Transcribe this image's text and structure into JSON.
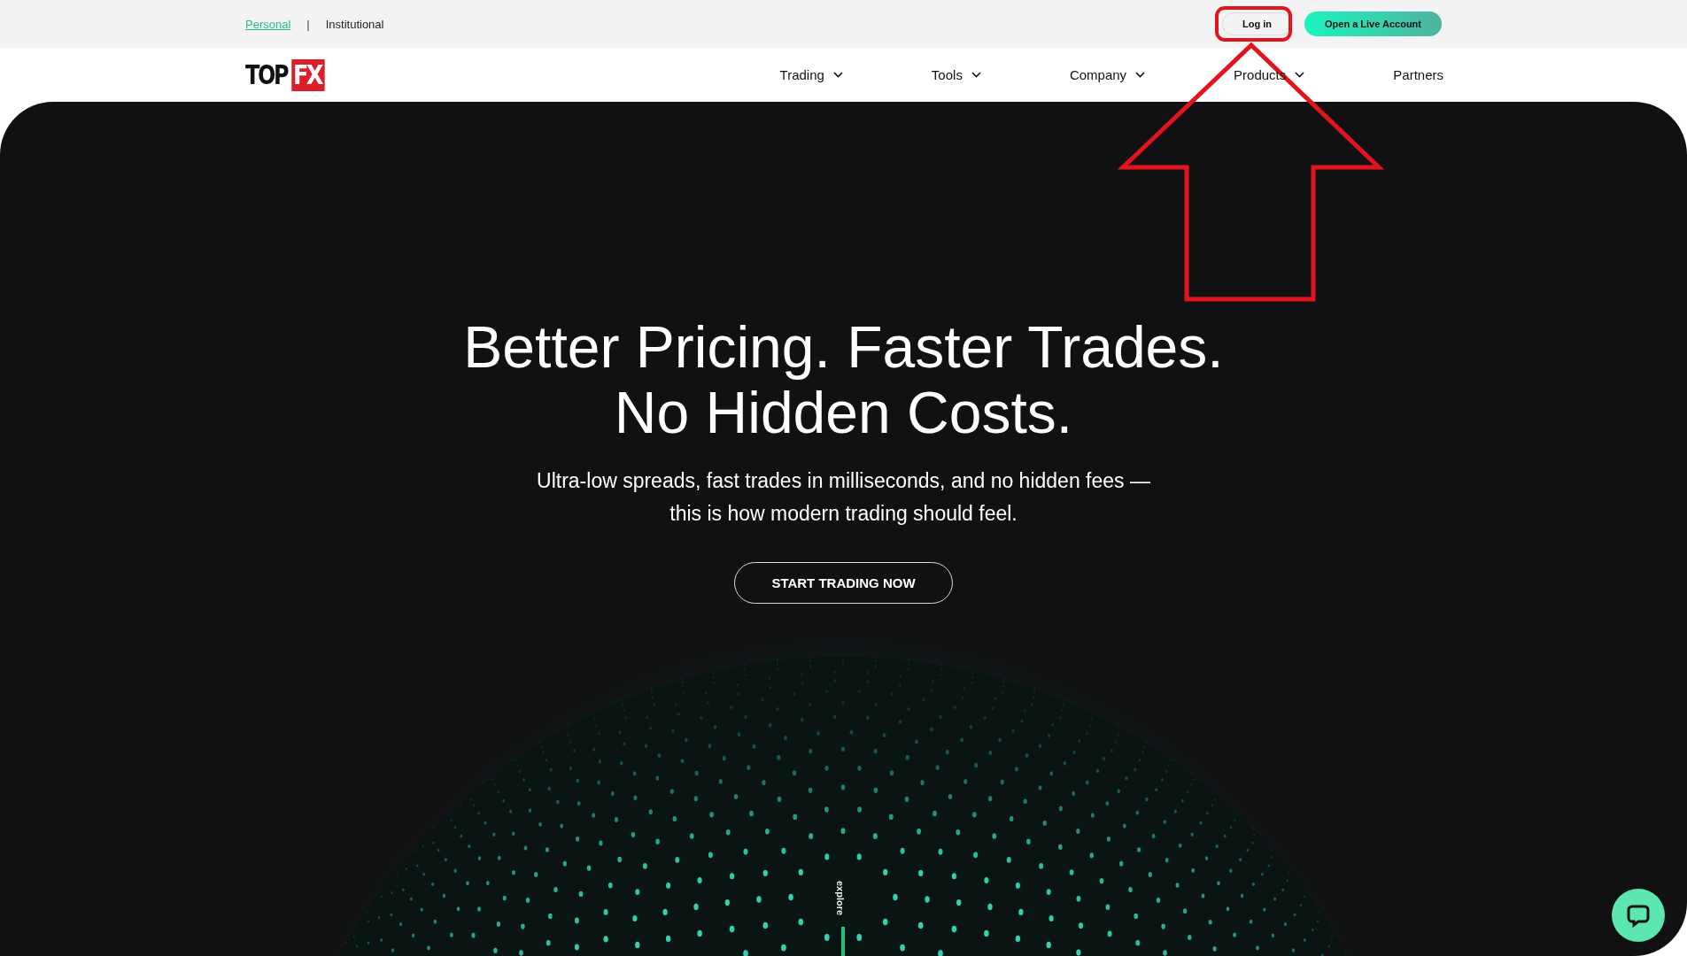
{
  "top_bar": {
    "segments": [
      {
        "label": "Personal",
        "selected": true
      },
      {
        "label": "Institutional",
        "selected": false
      }
    ],
    "separator": "|",
    "login": "Log in",
    "cta": "Open a Live Account"
  },
  "header": {
    "logo": {
      "plain": "TOP",
      "boxed": "FX"
    },
    "nav": [
      {
        "label": "Trading",
        "has_dropdown": true
      },
      {
        "label": "Tools",
        "has_dropdown": true
      },
      {
        "label": "Company",
        "has_dropdown": true
      },
      {
        "label": "Products",
        "has_dropdown": true
      },
      {
        "label": "Partners",
        "has_dropdown": false
      }
    ]
  },
  "hero": {
    "headline": [
      "Better Pricing. Faster Trades.",
      "No Hidden Costs."
    ],
    "subtitle": [
      "Ultra-low spreads, fast trades in milliseconds, and no hidden fees —",
      "this is how modern trading should feel."
    ],
    "button": "START TRADING NOW",
    "explore": "explore"
  }
}
